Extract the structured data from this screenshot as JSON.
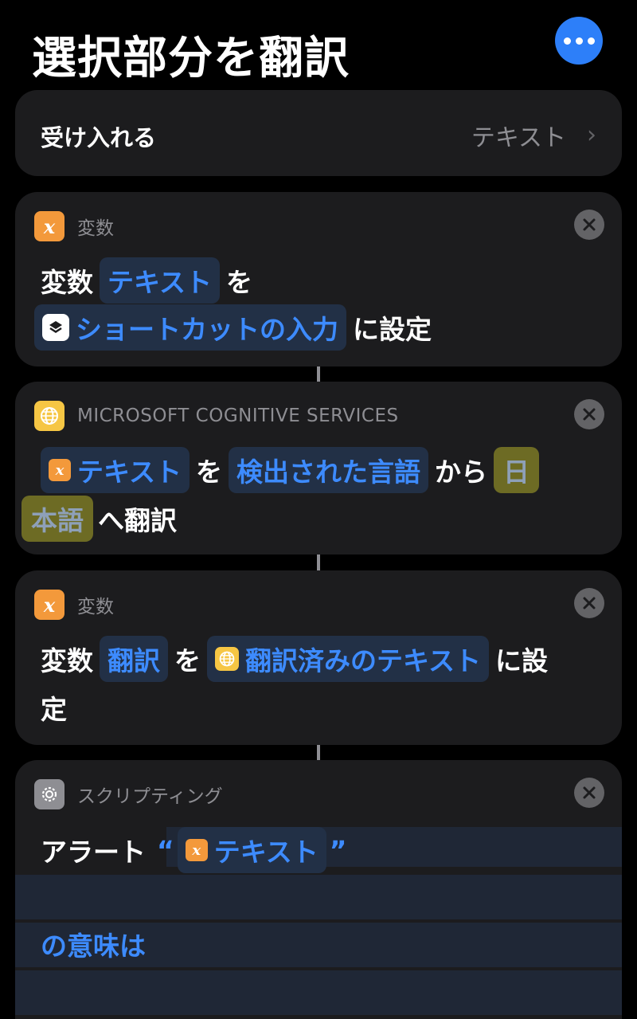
{
  "header": {
    "title": "選択部分を翻訳"
  },
  "accept": {
    "label": "受け入れる",
    "value": "テキスト"
  },
  "actions": [
    {
      "category": "変数",
      "icon": "variable-icon",
      "prefix": "変数",
      "variable_name": "テキスト",
      "particle": "を",
      "value_token": "ショートカットの入力",
      "suffix": "に設定"
    },
    {
      "category": "MICROSOFT COGNITIVE SERVICES",
      "icon": "globe-icon",
      "input_token": "テキスト",
      "particle": "を",
      "source_language": "検出された言語",
      "from_text": "から",
      "target_language_line1": "日",
      "target_language_line2": "本語",
      "suffix": "へ翻訳"
    },
    {
      "category": "変数",
      "icon": "variable-icon",
      "prefix": "変数",
      "variable_name": "翻訳",
      "particle": "を",
      "value_token": "翻訳済みのテキスト",
      "suffix_line1": "に設",
      "suffix_line2": "定"
    },
    {
      "category": "スクリプティング",
      "icon": "gear-icon",
      "prefix": "アラート",
      "open_quote": "“",
      "token": "テキスト",
      "close_quote": "”",
      "body_line": "の意味は"
    }
  ],
  "colors": {
    "background": "#000000",
    "card": "#1c1c1e",
    "accent_blue": "#3d8bff",
    "more_button": "#2d7ff9",
    "variable_orange": "#f3993b",
    "globe_yellow": "#f6c644",
    "highlight": "#6d6b24"
  }
}
